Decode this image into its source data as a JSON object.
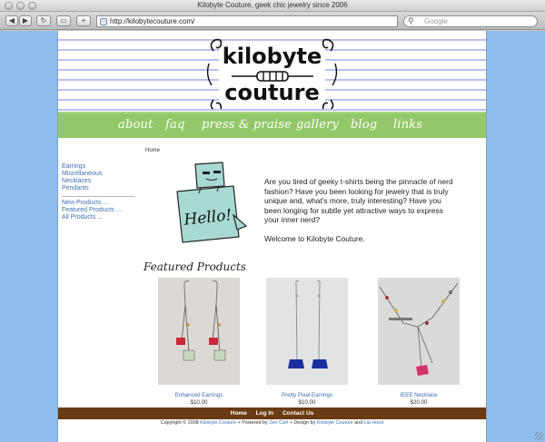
{
  "window": {
    "title": "Kilobyte Couture, geek chic jewelry since 2006"
  },
  "toolbar": {
    "url": "http://kilobytecouture.com/",
    "search_placeholder": "Google"
  },
  "logo": {
    "line1": "kilobyte",
    "line2": "couture"
  },
  "nav": {
    "items": [
      {
        "label": "about"
      },
      {
        "label": "faq"
      },
      {
        "label": "press & praise"
      },
      {
        "label": "gallery"
      },
      {
        "label": "blog"
      },
      {
        "label": "links"
      }
    ]
  },
  "breadcrumb": "Home",
  "sidebar": {
    "categories": [
      "Earrings",
      "Miscellaneous",
      "Necklaces",
      "Pendants"
    ],
    "links": [
      "New Products ...",
      "Featured Products ...",
      "All Products ..."
    ]
  },
  "hello_sign": "Hello!",
  "intro": {
    "paragraph1": "Are you tired of geeky t-shirts being the pinnacle of nerd fashion? Have you been looking for jewelry that is truly unique and, what's more, truly interesting? Have you been longing for subtle yet attractive ways to express your inner nerd?",
    "paragraph2": "Welcome to Kilobyte Couture."
  },
  "featured": {
    "title": "Featured Products",
    "products": [
      {
        "name": "Enhanced Earrings",
        "price": "$10.00"
      },
      {
        "name": "Pretty Pixel Earrings",
        "price": "$10.00"
      },
      {
        "name": "IEEE Necklace",
        "price": "$20.00"
      }
    ]
  },
  "footer": {
    "links": [
      "Home",
      "Log In",
      "Contact Us"
    ],
    "copyright_prefix": "Copyright © 2008",
    "site": "Kilobyte Couture",
    "powered_prefix": "+ Powered by",
    "powered": "Zen Cart",
    "design_prefix": "+ Design by",
    "designer1": "Kilobyte Couture",
    "and": "and",
    "designer2": "Lia Hood"
  },
  "colors": {
    "nav_green": "#93c86a",
    "footer_brown": "#6a3a12",
    "link_blue": "#3b6fb0",
    "desktop_blue": "#8fbdec"
  }
}
